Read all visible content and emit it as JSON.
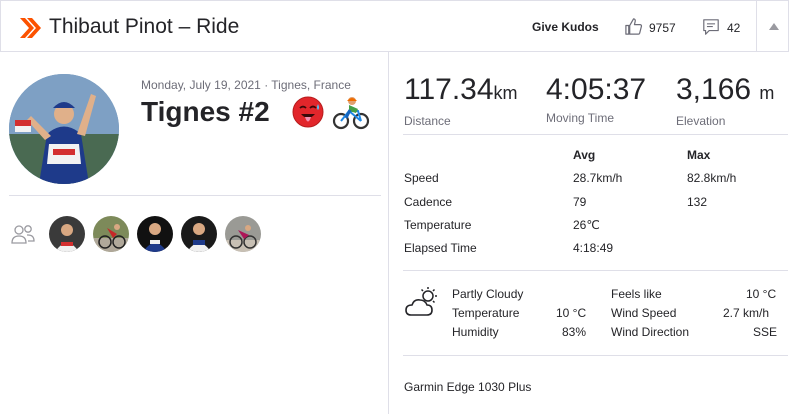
{
  "header": {
    "title": "Thibaut Pinot – Ride",
    "give_kudos": "Give Kudos",
    "kudos_count": "9757",
    "comments_count": "42"
  },
  "activity": {
    "date_location": "Monday, July 19, 2021 · Tignes, France",
    "title": "Tignes #2"
  },
  "summary": [
    {
      "value": "117.34",
      "unit": "km",
      "label": "Distance"
    },
    {
      "value": "4:05:37",
      "unit": "",
      "label": "Moving Time"
    },
    {
      "value": "3,166",
      "unit": "m",
      "label": "Elevation"
    }
  ],
  "stats_table": {
    "headers": [
      "",
      "Avg",
      "Max"
    ],
    "rows": [
      {
        "label": "Speed",
        "avg": "28.7km/h",
        "max": "82.8km/h"
      },
      {
        "label": "Cadence",
        "avg": "79",
        "max": "132"
      },
      {
        "label": "Temperature",
        "avg": "26℃",
        "max": ""
      },
      {
        "label": "Elapsed Time",
        "avg": "4:18:49",
        "max": ""
      }
    ]
  },
  "weather": {
    "condition": "Partly Cloudy",
    "temperature_label": "Temperature",
    "temperature_value": "10 °C",
    "humidity_label": "Humidity",
    "humidity_value": "83%",
    "feels_like_label": "Feels like",
    "feels_like_value": "10 °C",
    "wind_speed_label": "Wind Speed",
    "wind_speed_value": "2.7 km/h",
    "wind_direction_label": "Wind Direction",
    "wind_direction_value": "SSE"
  },
  "device": "Garmin Edge 1030 Plus",
  "icons": {
    "logo": "chevrons-icon",
    "kudos": "thumbs-up-icon",
    "comments": "comment-icon",
    "collapse": "caret-up-icon",
    "group": "group-icon",
    "weather": "partly-cloudy-icon"
  },
  "colors": {
    "brand": "#fc5200",
    "text": "#242428",
    "muted": "#6d6d78",
    "border": "#dfdfe8"
  }
}
